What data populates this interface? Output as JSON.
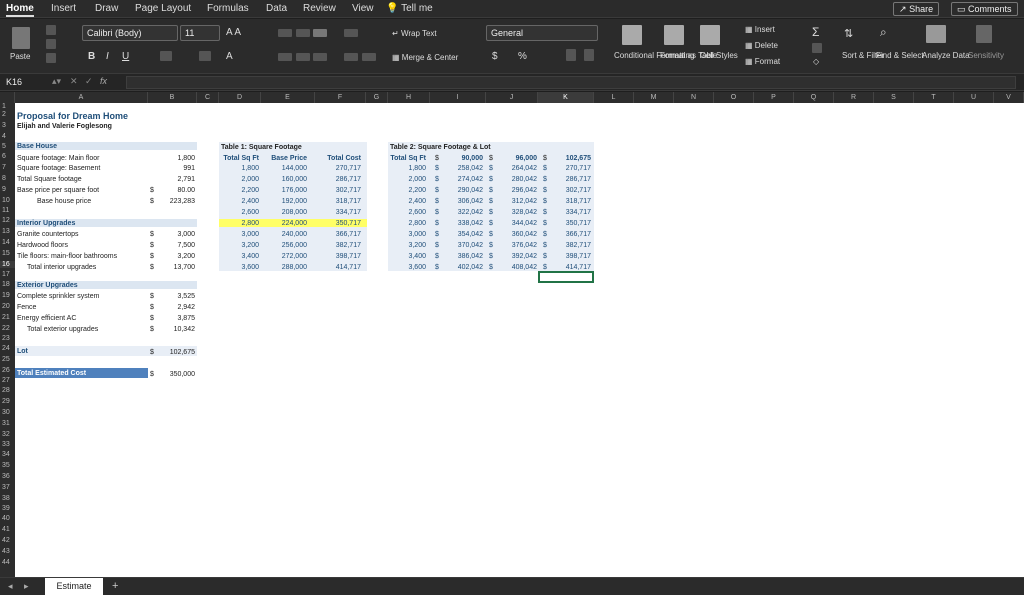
{
  "ribbon_tabs": [
    "Home",
    "Insert",
    "Draw",
    "Page Layout",
    "Formulas",
    "Data",
    "Review",
    "View"
  ],
  "tell_me": "Tell me",
  "share": "Share",
  "comments": "Comments",
  "font_name": "Calibri (Body)",
  "font_size": "11",
  "number_format": "General",
  "labels": {
    "paste": "Paste",
    "wrap_text": "Wrap Text",
    "merge_center": "Merge & Center",
    "conditional_formatting": "Conditional Formatting",
    "format_as_table": "Format as Table",
    "cell_styles": "Cell Styles",
    "insert": "Insert",
    "delete": "Delete",
    "format": "Format",
    "sort_filter": "Sort & Filter",
    "find_select": "Find & Select",
    "analyze_data": "Analyze Data",
    "sensitivity": "Sensitivity",
    "bold": "B",
    "italic": "I",
    "underline": "U",
    "fx": "fx",
    "percent": "%",
    "dollar": "$"
  },
  "name_box": "K16",
  "columns": [
    "A",
    "B",
    "C",
    "D",
    "E",
    "F",
    "G",
    "H",
    "I",
    "J",
    "K",
    "L",
    "M",
    "N",
    "O",
    "P",
    "Q",
    "R",
    "S",
    "T",
    "U",
    "V"
  ],
  "rows": [
    "1",
    "2",
    "3",
    "4",
    "5",
    "6",
    "7",
    "8",
    "9",
    "10",
    "11",
    "12",
    "13",
    "14",
    "15",
    "16",
    "17",
    "18",
    "19",
    "20",
    "21",
    "22",
    "23",
    "24",
    "25",
    "26",
    "27",
    "28",
    "29",
    "30",
    "31",
    "32",
    "33",
    "34",
    "35",
    "36",
    "37",
    "38",
    "39",
    "40",
    "41",
    "42",
    "43",
    "44"
  ],
  "sheet": {
    "title": "Proposal for Dream Home",
    "subtitle": "Elijah and Valerie Foglesong",
    "base_house": "Base House",
    "sq_main": "Square footage: Main floor",
    "sq_base": "Square footage: Basement",
    "sq_total": "Total Square footage",
    "base_price_sq": "Base price per square foot",
    "base_house_price": "Base house price",
    "interior": "Interior Upgrades",
    "granite": "Granite countertops",
    "hardwood": "Hardwood floors",
    "tile": "Tile floors: main-floor bathrooms",
    "total_interior": "Total interior upgrades",
    "exterior": "Exterior Upgrades",
    "sprinkler": "Complete sprinkler system",
    "fence": "Fence",
    "energy_ac": "Energy efficient AC",
    "total_exterior": "Total exterior upgrades",
    "lot": "Lot",
    "total_cost": "Total Estimated Cost",
    "v_main": "1,800",
    "v_base": "991",
    "v_total": "2,791",
    "v_price_sq": "80.00",
    "v_house": "223,283",
    "v_granite": "3,000",
    "v_hardwood": "7,500",
    "v_tile": "3,200",
    "v_tot_int": "13,700",
    "v_sprinkler": "3,525",
    "v_fence": "2,942",
    "v_ac": "3,875",
    "v_tot_ext": "10,342",
    "v_lot": "102,675",
    "v_total_cost": "350,000",
    "dollar": "$"
  },
  "table1": {
    "title": "Table 1: Square Footage",
    "headers": [
      "Total Sq Ft",
      "Base Price",
      "Total Cost"
    ],
    "rows": [
      [
        "1,800",
        "144,000",
        "270,717"
      ],
      [
        "2,000",
        "160,000",
        "286,717"
      ],
      [
        "2,200",
        "176,000",
        "302,717"
      ],
      [
        "2,400",
        "192,000",
        "318,717"
      ],
      [
        "2,600",
        "208,000",
        "334,717"
      ],
      [
        "2,800",
        "224,000",
        "350,717"
      ],
      [
        "3,000",
        "240,000",
        "366,717"
      ],
      [
        "3,200",
        "256,000",
        "382,717"
      ],
      [
        "3,400",
        "272,000",
        "398,717"
      ],
      [
        "3,600",
        "288,000",
        "414,717"
      ]
    ]
  },
  "table2": {
    "title": "Table 2: Square Footage & Lot",
    "header": "Total Sq Ft",
    "lot_headers": [
      "90,000",
      "96,000",
      "102,675"
    ],
    "rows": [
      [
        "1,800",
        "258,042",
        "264,042",
        "270,717"
      ],
      [
        "2,000",
        "274,042",
        "280,042",
        "286,717"
      ],
      [
        "2,200",
        "290,042",
        "296,042",
        "302,717"
      ],
      [
        "2,400",
        "306,042",
        "312,042",
        "318,717"
      ],
      [
        "2,600",
        "322,042",
        "328,042",
        "334,717"
      ],
      [
        "2,800",
        "338,042",
        "344,042",
        "350,717"
      ],
      [
        "3,000",
        "354,042",
        "360,042",
        "366,717"
      ],
      [
        "3,200",
        "370,042",
        "376,042",
        "382,717"
      ],
      [
        "3,400",
        "386,042",
        "392,042",
        "398,717"
      ],
      [
        "3,600",
        "402,042",
        "408,042",
        "414,717"
      ]
    ]
  },
  "sheet_tab": "Estimate",
  "add_sheet": "+"
}
